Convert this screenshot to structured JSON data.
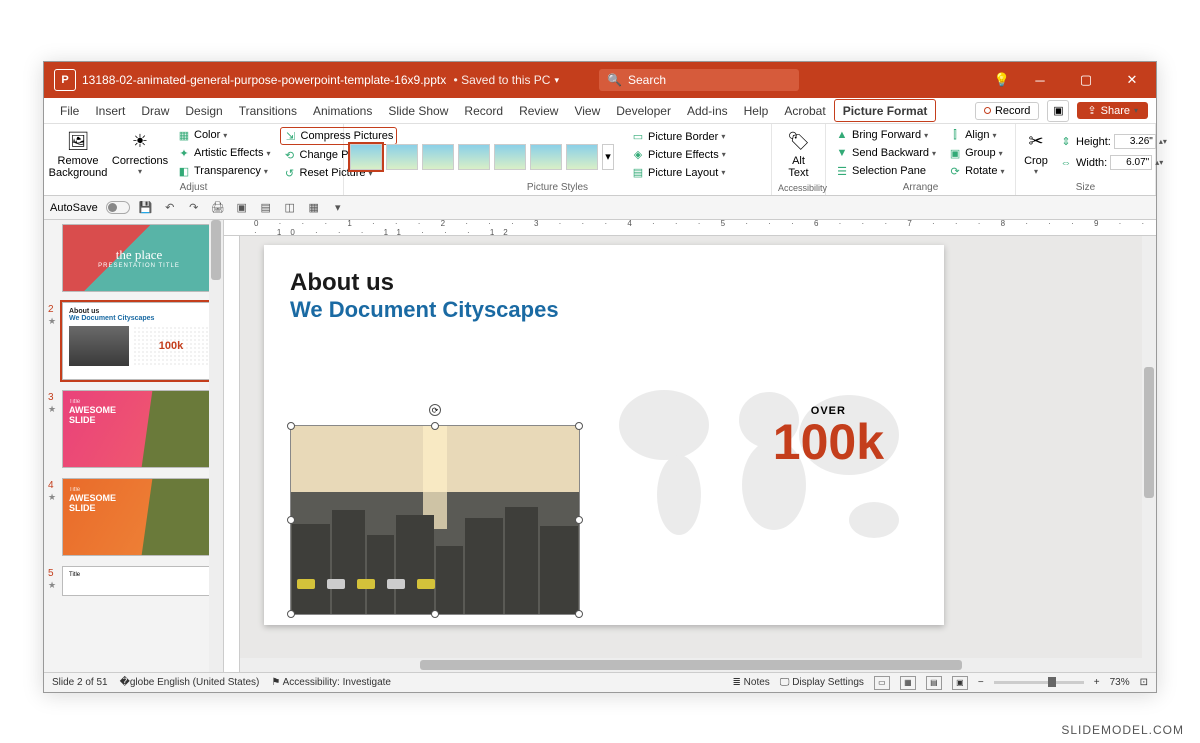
{
  "watermark": "SLIDEMODEL.COM",
  "titlebar": {
    "app_icon_letter": "P",
    "filename": "13188-02-animated-general-purpose-powerpoint-template-16x9.pptx",
    "saved_status": "Saved to this PC",
    "search_placeholder": "Search"
  },
  "tabs": {
    "items": [
      "File",
      "Insert",
      "Draw",
      "Design",
      "Transitions",
      "Animations",
      "Slide Show",
      "Record",
      "Review",
      "View",
      "Developer",
      "Add-ins",
      "Help",
      "Acrobat",
      "Picture Format"
    ],
    "active": "Picture Format",
    "record_label": "Record",
    "share_label": "Share"
  },
  "ribbon": {
    "remove_bg": "Remove\nBackground",
    "corrections": "Corrections",
    "color": "Color",
    "artistic": "Artistic Effects",
    "transparency": "Transparency",
    "compress": "Compress Pictures",
    "change": "Change Picture",
    "reset": "Reset Picture",
    "adjust_label": "Adjust",
    "styles_label": "Picture Styles",
    "border": "Picture Border",
    "effects": "Picture Effects",
    "layout": "Picture Layout",
    "alt_text": "Alt\nText",
    "accessibility_label": "Accessibility",
    "bring_forward": "Bring Forward",
    "send_backward": "Send Backward",
    "selection_pane": "Selection Pane",
    "align": "Align",
    "group": "Group",
    "rotate": "Rotate",
    "arrange_label": "Arrange",
    "crop": "Crop",
    "height_label": "Height:",
    "height_value": "3.26\"",
    "width_label": "Width:",
    "width_value": "6.07\"",
    "size_label": "Size"
  },
  "qat": {
    "autosave": "AutoSave"
  },
  "thumbs": {
    "s1": {
      "line1": "the place",
      "line2": "PRESENTATION TITLE"
    },
    "s2": {
      "num": "2",
      "title1": "About us",
      "title2": "We Document Cityscapes",
      "stat": "100k"
    },
    "s3": {
      "num": "3",
      "label": "Title",
      "title": "AWESOME\nSLIDE"
    },
    "s4": {
      "num": "4",
      "label": "Title",
      "title": "AWESOME\nSLIDE"
    },
    "s5": {
      "num": "5",
      "label": "Title"
    }
  },
  "slide": {
    "title1": "About us",
    "title2": "We Document Cityscapes",
    "over": "OVER",
    "stat": "100k"
  },
  "status": {
    "slide_info": "Slide 2 of 51",
    "language": "English (United States)",
    "accessibility": "Accessibility: Investigate",
    "notes": "Notes",
    "display": "Display Settings",
    "zoom": "73%"
  },
  "ruler": "0 · · · 1 · · · 2 · · · 3 · · · 4 · · · 5 · · · 6 · · · 7 · · · 8 · · · 9 · · · 10 · · · 11 · · · 12"
}
